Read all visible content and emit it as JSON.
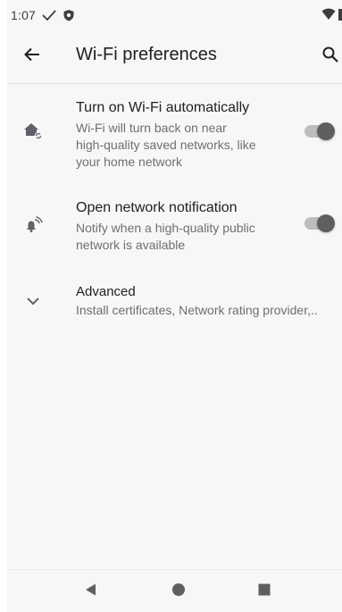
{
  "status_bar": {
    "time": "1:07",
    "icons": [
      "check-icon",
      "shield-icon",
      "wifi-icon",
      "battery-icon"
    ]
  },
  "app_bar": {
    "title": "Wi-Fi preferences",
    "back_icon": "arrow-back-icon",
    "search_icon": "search-icon"
  },
  "preferences": [
    {
      "title": "Turn on Wi-Fi automatically",
      "summary_lines": [
        "Wi-Fi will turn back on near",
        "high-quality saved networks, like",
        "your home network"
      ],
      "icon": "home-auto-icon",
      "toggle_on": true
    },
    {
      "title": "Open network notification",
      "summary_lines": [
        "Notify when a high-quality public",
        "network is available"
      ],
      "icon": "wifi-bell-icon",
      "toggle_on": true
    },
    {
      "title": "Advanced",
      "summary_lines": [
        "Install certificates, Network rating provider,.."
      ],
      "icon": "chevron-down-icon"
    }
  ],
  "nav_bar": {
    "icons": [
      "back-triangle-icon",
      "home-circle-icon",
      "recents-square-icon"
    ]
  },
  "colors": {
    "background": "#f7f7f7",
    "text_primary": "#202124",
    "text_secondary": "#6f6f6f",
    "toggle_thumb": "#5f5f5f",
    "toggle_track": "#bdbdbd"
  }
}
